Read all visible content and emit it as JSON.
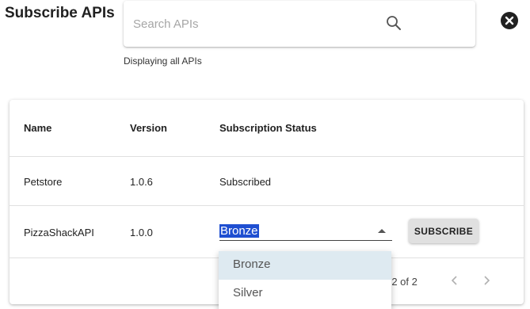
{
  "dialog": {
    "title": "Subscribe APIs",
    "close_icon": "close-circle-icon"
  },
  "search": {
    "placeholder": "Search APIs",
    "value": "",
    "icon": "search-icon",
    "hint": "Displaying all APIs"
  },
  "table": {
    "headers": {
      "name": "Name",
      "version": "Version",
      "status": "Subscription Status"
    },
    "rows": [
      {
        "name": "Petstore",
        "version": "1.0.6",
        "status": "Subscribed"
      },
      {
        "name": "PizzaShackAPI",
        "version": "1.0.0",
        "selected_tier": "Bronze",
        "action_label": "SUBSCRIBE"
      }
    ]
  },
  "tier_dropdown": {
    "options": [
      "Bronze",
      "Silver"
    ],
    "highlighted": "Bronze"
  },
  "pagination": {
    "label": "-2 of 2",
    "prev_icon": "chevron-left-icon",
    "next_icon": "chevron-right-icon"
  },
  "colors": {
    "selection_highlight": "#1f4fd1",
    "option_hover": "#deeaf1",
    "button_bg": "#e0e0e0"
  }
}
